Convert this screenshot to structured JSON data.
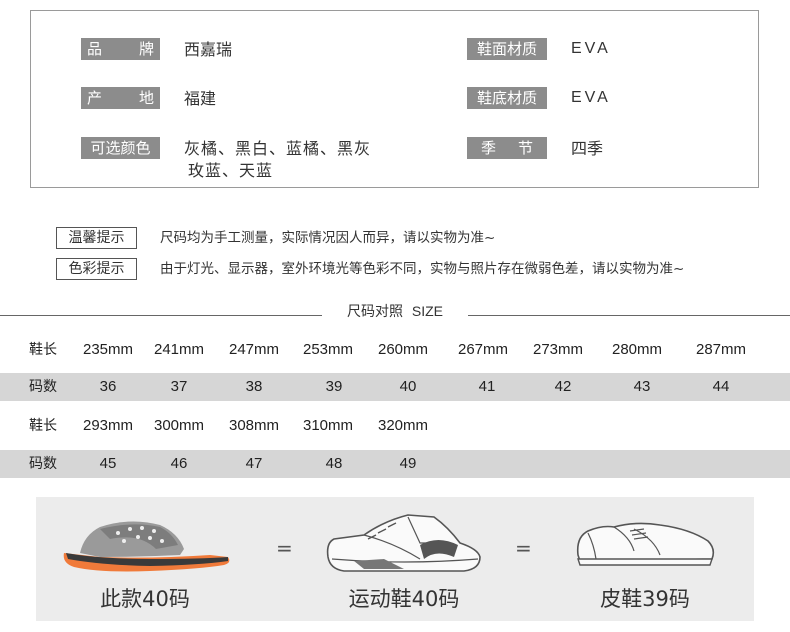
{
  "specs": {
    "brand": {
      "label_a": "品",
      "label_b": "牌",
      "value": "西嘉瑞"
    },
    "upper": {
      "label": "鞋面材质",
      "value": "EVA"
    },
    "origin": {
      "label_a": "产",
      "label_b": "地",
      "value": "福建"
    },
    "sole": {
      "label": "鞋底材质",
      "value": "EVA"
    },
    "colors": {
      "label": "可选颜色",
      "value_line1": "灰橘、黑白、蓝橘、黑灰",
      "value_line2": "玫蓝、天蓝"
    },
    "season": {
      "label_a": "季",
      "label_b": "节",
      "value": "四季"
    }
  },
  "tips": [
    {
      "label": "温馨提示",
      "text": "尺码均为手工测量，实际情况因人而异，请以实物为准~"
    },
    {
      "label": "色彩提示",
      "text": "由于灯光、显示器，室外环境光等色彩不同，实物与照片存在微弱色差，请以实物为准~"
    }
  ],
  "size_chart": {
    "title_cn": "尺码对照",
    "title_en": "SIZE",
    "length_label": "鞋长",
    "size_label": "码数",
    "lengths_row1": [
      "235mm",
      "241mm",
      "247mm",
      "253mm",
      "260mm",
      "267mm",
      "273mm",
      "280mm",
      "287mm"
    ],
    "sizes_row1": [
      "36",
      "37",
      "38",
      "39",
      "40",
      "41",
      "42",
      "43",
      "44"
    ],
    "lengths_row2": [
      "293mm",
      "300mm",
      "308mm",
      "310mm",
      "320mm"
    ],
    "sizes_row2": [
      "45",
      "46",
      "47",
      "48",
      "49"
    ]
  },
  "comparison": {
    "slide_caption": "此款40码",
    "sneaker_caption": "运动鞋40码",
    "dress_caption": "皮鞋39码",
    "equals": "="
  },
  "colors": {
    "label_bg": "#8c8c8c",
    "row_shade": "#d6d6d6",
    "panel_bg": "#ececec",
    "slide_sole": "#f07a3a",
    "slide_upper": "#9a9a9a"
  }
}
